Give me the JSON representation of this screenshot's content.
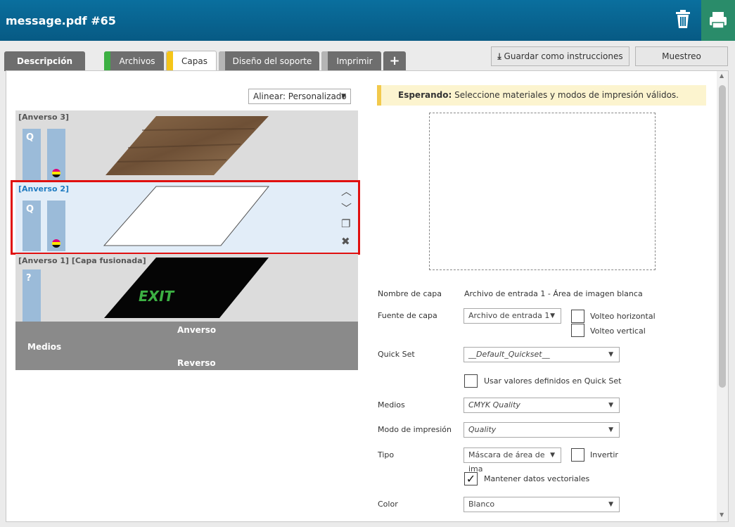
{
  "window": {
    "title": "message.pdf #65"
  },
  "tabs": [
    {
      "label": "Descripción",
      "stripe": ""
    },
    {
      "label": "Archivos",
      "stripe": "#3cb043"
    },
    {
      "label": "Capas",
      "stripe": "#f5c518"
    },
    {
      "label": "Diseño del soporte",
      "stripe": "#b5b5b5"
    },
    {
      "label": "Imprimir",
      "stripe": "#b5b5b5"
    }
  ],
  "add_tab_icon": "plus-icon",
  "toolbar": {
    "save_label": "Guardar como instrucciones",
    "sample_label": "Muestreo"
  },
  "align": {
    "label": "Alinear: Personalizado",
    "arrow": "▼"
  },
  "layers": [
    {
      "name": "[Anverso 3]",
      "q": "Q",
      "content": "wood"
    },
    {
      "name": "[Anverso 2]",
      "q": "Q",
      "content": "white",
      "selected": true
    },
    {
      "name": "[Anverso 1] [Capa fusionada]",
      "q": "?",
      "content": "exit",
      "text": "EXIT"
    }
  ],
  "medios": {
    "label": "Medios",
    "front": "Anverso",
    "back": "Reverso"
  },
  "status": {
    "strong": "Esperando:",
    "message": "Seleccione materiales y modos de impresión válidos."
  },
  "form": {
    "layer_name_label": "Nombre de capa",
    "layer_name_value": "Archivo de entrada 1 - Área de imagen blanca",
    "layer_source_label": "Fuente de capa",
    "layer_source_value": "Archivo de entrada 1",
    "flip_h_label": "Volteo horizontal",
    "flip_v_label": "Volteo vertical",
    "quickset_label": "Quick Set",
    "quickset_value": "__Default_Quickset__",
    "use_quickset_label": "Usar valores definidos en Quick Set",
    "media_label": "Medios",
    "media_value": "CMYK Quality",
    "print_mode_label": "Modo de impresión",
    "print_mode_value": "Quality",
    "type_label": "Tipo",
    "type_value": "Máscara de área de ima",
    "invert_label": "Invertir",
    "keep_vector_label": "Mantener datos vectoriales",
    "keep_vector_checked": true,
    "color_label": "Color",
    "color_value": "Blanco"
  },
  "colors": {
    "header": "#0a6f9e",
    "print": "#2a8c6a",
    "selection": "#e01010"
  }
}
